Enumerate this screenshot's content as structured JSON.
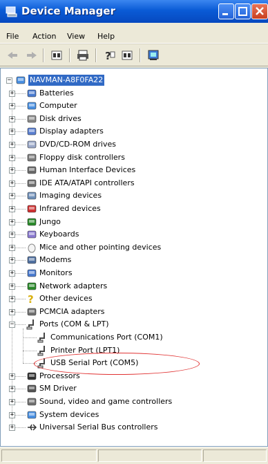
{
  "window": {
    "title": "Device Manager"
  },
  "menu": [
    "File",
    "Action",
    "View",
    "Help"
  ],
  "toolbar": [
    "back-icon",
    "forward-icon",
    "properties-icon",
    "print-icon",
    "help-icon",
    "view-icon",
    "scan-icon"
  ],
  "tree": {
    "root": "NAVMAN-A8F0FA22",
    "items": [
      {
        "label": "Batteries",
        "icon": "battery-icon",
        "expanded": false
      },
      {
        "label": "Computer",
        "icon": "computer-icon",
        "expanded": false
      },
      {
        "label": "Disk drives",
        "icon": "disk-drive-icon",
        "expanded": false
      },
      {
        "label": "Display adapters",
        "icon": "display-adapter-icon",
        "expanded": false
      },
      {
        "label": "DVD/CD-ROM drives",
        "icon": "cdrom-icon",
        "expanded": false
      },
      {
        "label": "Floppy disk controllers",
        "icon": "floppy-controller-icon",
        "expanded": false
      },
      {
        "label": "Human Interface Devices",
        "icon": "hid-icon",
        "expanded": false
      },
      {
        "label": "IDE ATA/ATAPI controllers",
        "icon": "ide-controller-icon",
        "expanded": false
      },
      {
        "label": "Imaging devices",
        "icon": "imaging-icon",
        "expanded": false
      },
      {
        "label": "Infrared devices",
        "icon": "infrared-icon",
        "expanded": false
      },
      {
        "label": "Jungo",
        "icon": "jungo-icon",
        "expanded": false
      },
      {
        "label": "Keyboards",
        "icon": "keyboard-icon",
        "expanded": false
      },
      {
        "label": "Mice and other pointing devices",
        "icon": "mouse-icon",
        "expanded": false
      },
      {
        "label": "Modems",
        "icon": "modem-icon",
        "expanded": false
      },
      {
        "label": "Monitors",
        "icon": "monitor-icon",
        "expanded": false
      },
      {
        "label": "Network adapters",
        "icon": "network-adapter-icon",
        "expanded": false
      },
      {
        "label": "Other devices",
        "icon": "other-devices-icon",
        "expanded": false
      },
      {
        "label": "PCMCIA adapters",
        "icon": "pcmcia-icon",
        "expanded": false
      },
      {
        "label": "Ports (COM & LPT)",
        "icon": "port-icon",
        "expanded": true,
        "children": [
          {
            "label": "Communications Port (COM1)",
            "icon": "port-icon"
          },
          {
            "label": "Printer Port (LPT1)",
            "icon": "port-icon"
          },
          {
            "label": "USB Serial Port (COM5)",
            "icon": "port-icon",
            "circled": true
          }
        ]
      },
      {
        "label": "Processors",
        "icon": "processor-icon",
        "expanded": false
      },
      {
        "label": "SM Driver",
        "icon": "sm-driver-icon",
        "expanded": false
      },
      {
        "label": "Sound, video and game controllers",
        "icon": "sound-icon",
        "expanded": false
      },
      {
        "label": "System devices",
        "icon": "system-devices-icon",
        "expanded": false
      },
      {
        "label": "Universal Serial Bus controllers",
        "icon": "usb-icon",
        "expanded": false
      }
    ]
  },
  "colors": {
    "titlebar": "#0a5bd6",
    "selection": "#316ac5",
    "annotation": "#e03030"
  }
}
